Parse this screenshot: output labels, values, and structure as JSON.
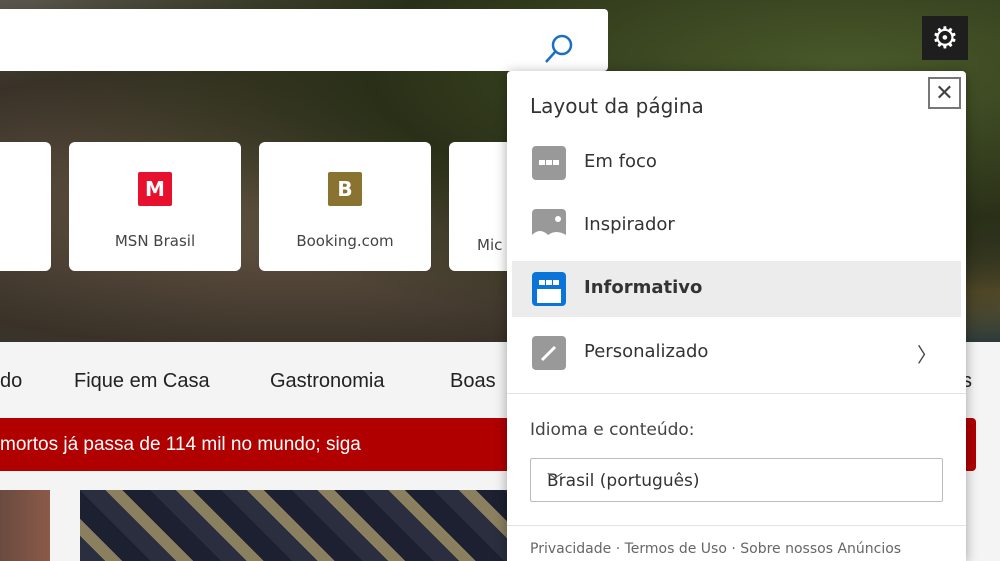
{
  "search": {
    "icon": "search-icon"
  },
  "settings": {
    "icon": "gear-icon"
  },
  "tiles": [
    {
      "label": "MSN Brasil",
      "letter": "M",
      "color": "#e8112d"
    },
    {
      "label": "Booking.com",
      "letter": "B",
      "color": "#8a7230"
    },
    {
      "label": "Mic"
    }
  ],
  "nav": [
    "do",
    "Fique em Casa",
    "Gastronomia",
    "Boas",
    "s"
  ],
  "banner": "mortos já passa de 114 mil no mundo; siga",
  "panel": {
    "title": "Layout da página",
    "items": [
      {
        "label": "Em foco",
        "icon": "focus-layout-icon"
      },
      {
        "label": "Inspirador",
        "icon": "image-layout-icon"
      },
      {
        "label": "Informativo",
        "icon": "informational-layout-icon",
        "selected": true
      },
      {
        "label": "Personalizado",
        "icon": "pencil-icon"
      }
    ],
    "lang_label": "Idioma e conteúdo:",
    "lang_value": "Brasil (português)",
    "footer": "Privacidade · Termos de Uso · Sobre nossos Anúncios"
  }
}
